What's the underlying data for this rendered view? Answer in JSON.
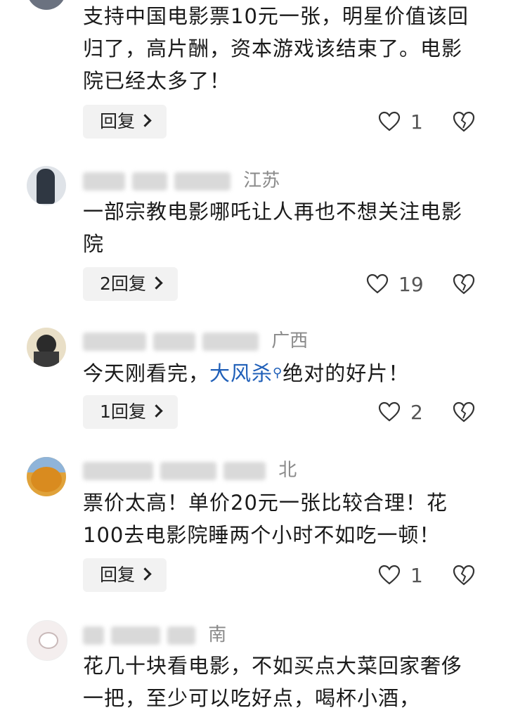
{
  "comments": [
    {
      "text": "支持中国电影票10元一张，明星价值该回归了，高片酬，资本游戏该结束了。电影院已经太多了！",
      "reply_label": "回复",
      "likes": "1"
    },
    {
      "location": "江苏",
      "text": "一部宗教电影哪吒让人再也不想关注电影院",
      "reply_label": "2回复",
      "likes": "19"
    },
    {
      "location": "广西",
      "text_before": "今天刚看完，",
      "link": "大风杀",
      "text_after": "绝对的好片！",
      "reply_label": "1回复",
      "likes": "2"
    },
    {
      "location": "北",
      "text": "票价太高！单价20元一张比较合理！花100去电影院睡两个小时不如吃一顿！",
      "reply_label": "回复",
      "likes": "1"
    },
    {
      "location": "南",
      "text": "花几十块看电影，不如买点大菜回家奢侈一把，至少可以吃好点，喝杯小酒，"
    }
  ],
  "colors": {
    "link": "#1f5fb8",
    "reply_bg": "#f2f2f2",
    "meta": "#8a8a8a"
  }
}
